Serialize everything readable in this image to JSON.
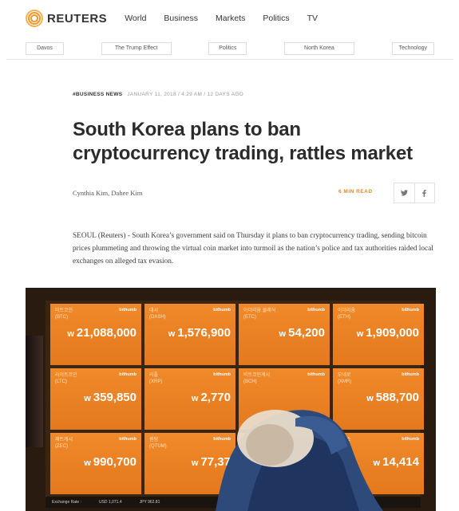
{
  "header": {
    "logo_text": "REUTERS",
    "nav": [
      "World",
      "Business",
      "Markets",
      "Politics",
      "TV"
    ]
  },
  "tags": [
    "Davos",
    "The Trump Effect",
    "Politics",
    "North Korea",
    "Technology"
  ],
  "article": {
    "category": "#BUSINESS NEWS",
    "dateline": "JANUARY 11, 2018 / 4:29 AM / 12 DAYS AGO",
    "headline": "South Korea plans to ban cryptocurrency trading, rattles market",
    "byline": "Cynthia Kim, Dahee Kim",
    "read_time": "6 MIN READ",
    "share_twitter": "t",
    "share_facebook": "f",
    "lede": "SEOUL (Reuters) - South Korea’s government said on Thursday it plans to ban cryptocurrency trading, sending bitcoin prices plummeting and throwing the virtual coin market into turmoil as the nation’s police and tax authorities raided local exchanges on alleged tax evasion."
  },
  "photo": {
    "board_brand": "bithumb",
    "tiles": [
      {
        "name": "비트코인\n(BTC)",
        "price": "21,088,000"
      },
      {
        "name": "대시\n(DASH)",
        "price": "1,576,900"
      },
      {
        "name": "이더리움 클래식\n(ETC)",
        "price": "54,200"
      },
      {
        "name": "이더리움\n(ETH)",
        "price": "1,909,000"
      },
      {
        "name": "라이트코인\n(LTC)",
        "price": "359,850"
      },
      {
        "name": "리플\n(XRP)",
        "price": "2,770"
      },
      {
        "name": "비트코인캐시\n(BCH)",
        "price": ""
      },
      {
        "name": "모네로\n(XMR)",
        "price": "588,700"
      },
      {
        "name": "제트캐시\n(ZEC)",
        "price": "990,700"
      },
      {
        "name": "퀀텀\n(QTUM)",
        "price": "77,37"
      },
      {
        "name": "",
        "price": ""
      },
      {
        "name": "이오스\n(EOS)",
        "price": "14,414"
      }
    ],
    "currency_symbol": "w",
    "footer": [
      "Exchange Rate :",
      "USD 1,071.4",
      "JPY 962.81"
    ]
  }
}
